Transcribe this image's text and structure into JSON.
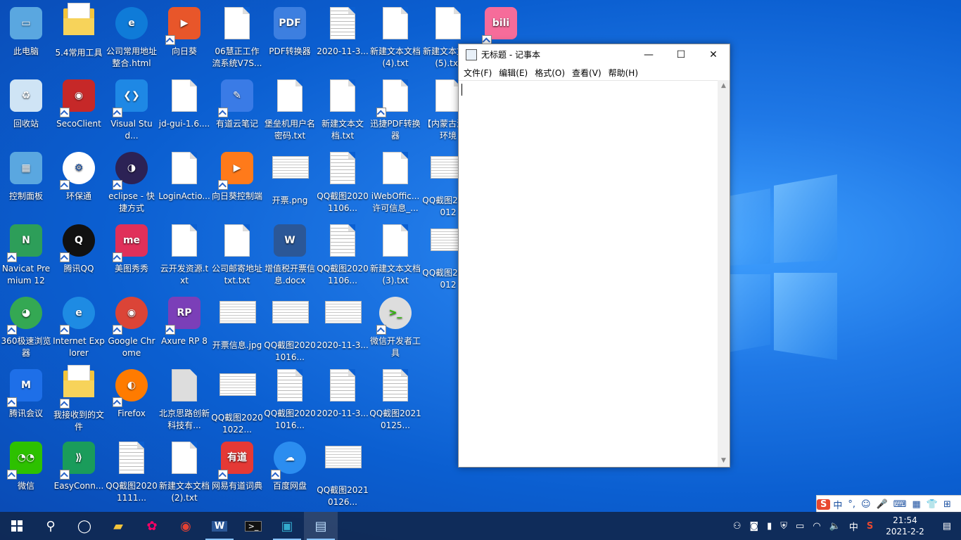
{
  "colors": {
    "desktop": "#0b5fd1",
    "taskbar": "#102850",
    "ime_brand": "#e8482f"
  },
  "desktop_icons": [
    {
      "label": "此电脑",
      "type": "computer",
      "shortcut": false
    },
    {
      "label": "5.4常用工具",
      "type": "folder",
      "shortcut": false
    },
    {
      "label": "公司常用地址整合.html",
      "type": "edge",
      "shortcut": false
    },
    {
      "label": "向日葵",
      "type": "sunlogin",
      "shortcut": true
    },
    {
      "label": "06慧正工作流系统V7S...",
      "type": "doc",
      "shortcut": false
    },
    {
      "label": "PDF转换器",
      "type": "pdf",
      "shortcut": false
    },
    {
      "label": "2020-11-3...",
      "type": "docl",
      "shortcut": false
    },
    {
      "label": "新建文本文档 (4).txt",
      "type": "doc",
      "shortcut": false
    },
    {
      "label": "新建文本文档 (5).txt",
      "type": "doc",
      "shortcut": false
    },
    {
      "label": "",
      "type": "bilibili",
      "shortcut": true
    },
    {
      "label": "回收站",
      "type": "recycle",
      "shortcut": false
    },
    {
      "label": "SecoClient",
      "type": "seco",
      "shortcut": true
    },
    {
      "label": "Visual Stud...",
      "type": "vscode",
      "shortcut": true
    },
    {
      "label": "jd-gui-1.6....",
      "type": "doc",
      "shortcut": false
    },
    {
      "label": "有道云笔记",
      "type": "youdao",
      "shortcut": true
    },
    {
      "label": "堡垒机用户名密码.txt",
      "type": "doc",
      "shortcut": false
    },
    {
      "label": "新建文本文档.txt",
      "type": "doc",
      "shortcut": false
    },
    {
      "label": "迅捷PDF转换器",
      "type": "doc",
      "shortcut": true
    },
    {
      "label": "【内蒙古治区环境",
      "type": "doc",
      "shortcut": false
    },
    {
      "label": "控制面板",
      "type": "control",
      "shortcut": false
    },
    {
      "label": "环保通",
      "type": "hbt",
      "shortcut": true
    },
    {
      "label": "eclipse - 快捷方式",
      "type": "eclipse",
      "shortcut": true
    },
    {
      "label": "LoginActio...",
      "type": "doc",
      "shortcut": false
    },
    {
      "label": "向日葵控制端",
      "type": "sunlogin2",
      "shortcut": true
    },
    {
      "label": "开票.png",
      "type": "qr",
      "shortcut": false
    },
    {
      "label": "QQ截图20201106...",
      "type": "docl",
      "shortcut": false
    },
    {
      "label": "iWebOffic...许可信息_...",
      "type": "doc",
      "shortcut": false
    },
    {
      "label": "QQ截图2021012",
      "type": "thumb",
      "shortcut": false
    },
    {
      "label": "Navicat Premium 12",
      "type": "navicat",
      "shortcut": true
    },
    {
      "label": "腾讯QQ",
      "type": "qq",
      "shortcut": true
    },
    {
      "label": "美图秀秀",
      "type": "meitu",
      "shortcut": true
    },
    {
      "label": "云开发资源.txt",
      "type": "doc",
      "shortcut": false
    },
    {
      "label": "公司邮寄地址txt.txt",
      "type": "doc",
      "shortcut": false
    },
    {
      "label": "增值税开票信息.docx",
      "type": "word",
      "shortcut": false
    },
    {
      "label": "QQ截图20201106...",
      "type": "docl",
      "shortcut": false
    },
    {
      "label": "新建文本文档 (3).txt",
      "type": "doc",
      "shortcut": false
    },
    {
      "label": "QQ截图2021012",
      "type": "thumb",
      "shortcut": false
    },
    {
      "label": "360极速浏览器",
      "type": "b360",
      "shortcut": true
    },
    {
      "label": "Internet Explorer",
      "type": "ie",
      "shortcut": true
    },
    {
      "label": "Google Chrome",
      "type": "chrome",
      "shortcut": true
    },
    {
      "label": "Axure RP 8",
      "type": "axure",
      "shortcut": true
    },
    {
      "label": "开票信息.jpg",
      "type": "thumb",
      "shortcut": false
    },
    {
      "label": "QQ截图20201016...",
      "type": "thumb",
      "shortcut": false
    },
    {
      "label": "2020-11-3...",
      "type": "thumb",
      "shortcut": false
    },
    {
      "label": "微信开发者工具",
      "type": "wxdev",
      "shortcut": true
    },
    {
      "label": "腾讯会议",
      "type": "meeting",
      "shortcut": true
    },
    {
      "label": "我接收到的文件",
      "type": "folder",
      "shortcut": true
    },
    {
      "label": "Firefox",
      "type": "firefox",
      "shortcut": true
    },
    {
      "label": "北京思路创新科技有...",
      "type": "photo",
      "shortcut": false
    },
    {
      "label": "QQ截图20201022...",
      "type": "thumb",
      "shortcut": false
    },
    {
      "label": "QQ截图20201016...",
      "type": "docl",
      "shortcut": false
    },
    {
      "label": "2020-11-3...",
      "type": "docl",
      "shortcut": false
    },
    {
      "label": "QQ截图20210125...",
      "type": "docl",
      "shortcut": false
    },
    {
      "label": "微信",
      "type": "wechat",
      "shortcut": true
    },
    {
      "label": "EasyConn...",
      "type": "easyconn",
      "shortcut": true
    },
    {
      "label": "QQ截图20201111...",
      "type": "docl",
      "shortcut": false
    },
    {
      "label": "新建文本文档 (2).txt",
      "type": "doc",
      "shortcut": false
    },
    {
      "label": "网易有道词典",
      "type": "ydcd",
      "shortcut": true
    },
    {
      "label": "百度网盘",
      "type": "baidu",
      "shortcut": true
    },
    {
      "label": "QQ截图20210126...",
      "type": "thumb",
      "shortcut": false
    }
  ],
  "notepad": {
    "title": "无标题 - 记事本",
    "menu": [
      "文件(F)",
      "编辑(E)",
      "格式(O)",
      "查看(V)",
      "帮助(H)"
    ],
    "content": ""
  },
  "ime": {
    "brand": "S",
    "mode": "中",
    "punct": "°,"
  },
  "taskbar": {
    "tray_lang": "中",
    "time": "21:54",
    "date": "2021-2-2"
  }
}
